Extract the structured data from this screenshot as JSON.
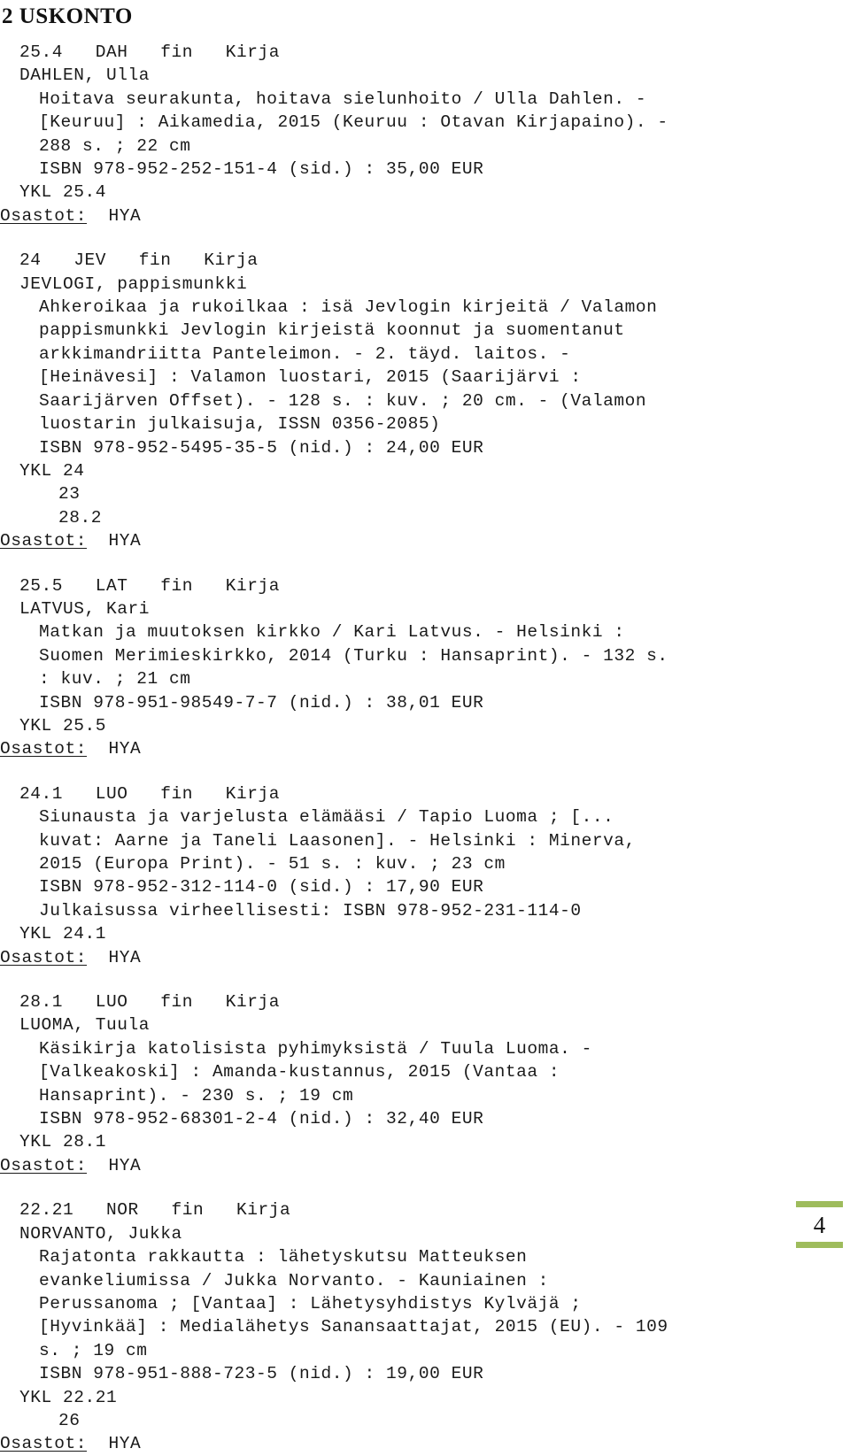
{
  "document": {
    "section_heading": "2 USKONTO",
    "osastot_label": "Osastot:",
    "page_number": "4",
    "accent_color": "#9ebc5c"
  },
  "records": [
    {
      "id": "record-dahlen",
      "lines": [
        {
          "indent": 2,
          "text": "25.4   DAH   fin   Kirja"
        },
        {
          "indent": 2,
          "text": "DAHLEN, Ulla"
        },
        {
          "indent": 4,
          "text": "Hoitava seurakunta, hoitava sielunhoito / Ulla Dahlen. -"
        },
        {
          "indent": 4,
          "text": "[Keuruu] : Aikamedia, 2015 (Keuruu : Otavan Kirjapaino). -"
        },
        {
          "indent": 4,
          "text": "288 s. ; 22 cm"
        },
        {
          "indent": 4,
          "text": "ISBN 978-952-252-151-4 (sid.) : 35,00 EUR"
        },
        {
          "indent": 2,
          "text": "YKL 25.4"
        }
      ],
      "osastot_value": "HYA"
    },
    {
      "id": "record-jevlogi",
      "lines": [
        {
          "indent": 2,
          "text": "24   JEV   fin   Kirja"
        },
        {
          "indent": 2,
          "text": "JEVLOGI, pappismunkki"
        },
        {
          "indent": 4,
          "text": "Ahkeroikaa ja rukoilkaa : isä Jevlogin kirjeitä / Valamon"
        },
        {
          "indent": 4,
          "text": "pappismunkki Jevlogin kirjeistä koonnut ja suomentanut"
        },
        {
          "indent": 4,
          "text": "arkkimandriitta Panteleimon. - 2. täyd. laitos. -"
        },
        {
          "indent": 4,
          "text": "[Heinävesi] : Valamon luostari, 2015 (Saarijärvi :"
        },
        {
          "indent": 4,
          "text": "Saarijärven Offset). - 128 s. : kuv. ; 20 cm. - (Valamon"
        },
        {
          "indent": 4,
          "text": "luostarin julkaisuja, ISSN 0356-2085)"
        },
        {
          "indent": 4,
          "text": "ISBN 978-952-5495-35-5 (nid.) : 24,00 EUR"
        },
        {
          "indent": 2,
          "text": "YKL 24"
        },
        {
          "indent": 6,
          "text": "23"
        },
        {
          "indent": 6,
          "text": "28.2"
        }
      ],
      "osastot_value": "HYA"
    },
    {
      "id": "record-latvus",
      "lines": [
        {
          "indent": 2,
          "text": "25.5   LAT   fin   Kirja"
        },
        {
          "indent": 2,
          "text": "LATVUS, Kari"
        },
        {
          "indent": 4,
          "text": "Matkan ja muutoksen kirkko / Kari Latvus. - Helsinki :"
        },
        {
          "indent": 4,
          "text": "Suomen Merimieskirkko, 2014 (Turku : Hansaprint). - 132 s."
        },
        {
          "indent": 4,
          "text": ": kuv. ; 21 cm"
        },
        {
          "indent": 4,
          "text": "ISBN 978-951-98549-7-7 (nid.) : 38,01 EUR"
        },
        {
          "indent": 2,
          "text": "YKL 25.5"
        }
      ],
      "osastot_value": "HYA"
    },
    {
      "id": "record-luoma-tapio",
      "lines": [
        {
          "indent": 2,
          "text": "24.1   LUO   fin   Kirja"
        },
        {
          "indent": 4,
          "text": "Siunausta ja varjelusta elämääsi / Tapio Luoma ; [..."
        },
        {
          "indent": 4,
          "text": "kuvat: Aarne ja Taneli Laasonen]. - Helsinki : Minerva,"
        },
        {
          "indent": 4,
          "text": "2015 (Europa Print). - 51 s. : kuv. ; 23 cm"
        },
        {
          "indent": 4,
          "text": "ISBN 978-952-312-114-0 (sid.) : 17,90 EUR"
        },
        {
          "indent": 4,
          "text": "Julkaisussa virheellisesti: ISBN 978-952-231-114-0"
        },
        {
          "indent": 2,
          "text": "YKL 24.1"
        }
      ],
      "osastot_value": "HYA"
    },
    {
      "id": "record-luoma-tuula",
      "lines": [
        {
          "indent": 2,
          "text": "28.1   LUO   fin   Kirja"
        },
        {
          "indent": 2,
          "text": "LUOMA, Tuula"
        },
        {
          "indent": 4,
          "text": "Käsikirja katolisista pyhimyksistä / Tuula Luoma. -"
        },
        {
          "indent": 4,
          "text": "[Valkeakoski] : Amanda-kustannus, 2015 (Vantaa :"
        },
        {
          "indent": 4,
          "text": "Hansaprint). - 230 s. ; 19 cm"
        },
        {
          "indent": 4,
          "text": "ISBN 978-952-68301-2-4 (nid.) : 32,40 EUR"
        },
        {
          "indent": 2,
          "text": "YKL 28.1"
        }
      ],
      "osastot_value": "HYA"
    },
    {
      "id": "record-norvanto",
      "lines": [
        {
          "indent": 2,
          "text": "22.21   NOR   fin   Kirja"
        },
        {
          "indent": 2,
          "text": "NORVANTO, Jukka"
        },
        {
          "indent": 4,
          "text": "Rajatonta rakkautta : lähetyskutsu Matteuksen"
        },
        {
          "indent": 4,
          "text": "evankeliumissa / Jukka Norvanto. - Kauniainen :"
        },
        {
          "indent": 4,
          "text": "Perussanoma ; [Vantaa] : Lähetysyhdistys Kylväjä ;"
        },
        {
          "indent": 4,
          "text": "[Hyvinkää] : Medialähetys Sanansaattajat, 2015 (EU). - 109"
        },
        {
          "indent": 4,
          "text": "s. ; 19 cm"
        },
        {
          "indent": 4,
          "text": "ISBN 978-951-888-723-5 (nid.) : 19,00 EUR"
        },
        {
          "indent": 2,
          "text": "YKL 22.21"
        },
        {
          "indent": 6,
          "text": "26"
        }
      ],
      "osastot_value": "HYA"
    }
  ]
}
